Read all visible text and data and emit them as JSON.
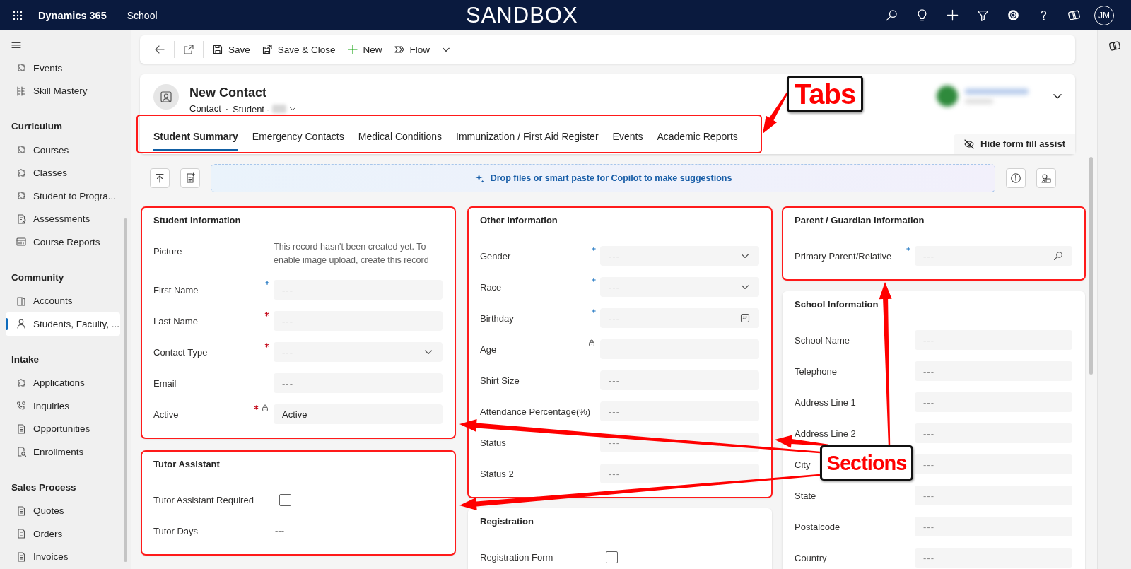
{
  "top_bar": {
    "app_name": "Dynamics 365",
    "area": "School",
    "environment": "SANDBOX",
    "user_initials": "JM"
  },
  "sidebar": {
    "groups": [
      {
        "items": [
          {
            "label": "Events",
            "selected": false
          },
          {
            "label": "Skill Mastery",
            "selected": false
          }
        ]
      },
      {
        "title": "Curriculum",
        "items": [
          {
            "label": "Courses",
            "selected": false
          },
          {
            "label": "Classes",
            "selected": false
          },
          {
            "label": "Student to Progra...",
            "selected": false
          },
          {
            "label": "Assessments",
            "selected": false
          },
          {
            "label": "Course Reports",
            "selected": false
          }
        ]
      },
      {
        "title": "Community",
        "items": [
          {
            "label": "Accounts",
            "selected": false
          },
          {
            "label": "Students, Faculty, ...",
            "selected": true
          }
        ]
      },
      {
        "title": "Intake",
        "items": [
          {
            "label": "Applications",
            "selected": false
          },
          {
            "label": "Inquiries",
            "selected": false
          },
          {
            "label": "Opportunities",
            "selected": false
          },
          {
            "label": "Enrollments",
            "selected": false
          }
        ]
      },
      {
        "title": "Sales Process",
        "items": [
          {
            "label": "Quotes",
            "selected": false
          },
          {
            "label": "Orders",
            "selected": false
          },
          {
            "label": "Invoices",
            "selected": false
          }
        ]
      }
    ]
  },
  "command_bar": {
    "commands": [
      {
        "label": "Save",
        "menu": false
      },
      {
        "label": "Save & Close",
        "menu": false
      },
      {
        "label": "New",
        "menu": false
      },
      {
        "label": "Flow",
        "menu": true
      }
    ]
  },
  "record": {
    "title": "New Contact",
    "entity": "Contact",
    "separator": "·",
    "form_name": "Student -"
  },
  "tabs": [
    {
      "label": "Student Summary",
      "selected": true
    },
    {
      "label": "Emergency Contacts",
      "selected": false
    },
    {
      "label": "Medical Conditions",
      "selected": false
    },
    {
      "label": "Immunization / First Aid Register",
      "selected": false
    },
    {
      "label": "Events",
      "selected": false
    },
    {
      "label": "Academic Reports",
      "selected": false
    }
  ],
  "form_fill_assist": "Hide form fill assist",
  "copilot_prompt": "Drop files or smart paste for Copilot to make suggestions",
  "columns": [
    {
      "sections": [
        {
          "title": "Student Information",
          "highlighted": true,
          "fields": [
            {
              "label": "Picture",
              "kind": "note",
              "required": false,
              "recommended": false,
              "locked": false,
              "value": "This record hasn't been created yet. To enable image upload, create this record"
            },
            {
              "label": "First Name",
              "kind": "text",
              "required": false,
              "recommended": true,
              "locked": false,
              "placeholder": "---"
            },
            {
              "label": "Last Name",
              "kind": "text",
              "required": true,
              "recommended": false,
              "locked": false,
              "placeholder": "---"
            },
            {
              "label": "Contact Type",
              "kind": "select",
              "required": true,
              "recommended": false,
              "locked": false,
              "placeholder": "---"
            },
            {
              "label": "Email",
              "kind": "text",
              "required": false,
              "recommended": false,
              "locked": false,
              "placeholder": "---"
            },
            {
              "label": "Active",
              "kind": "text",
              "required": true,
              "recommended": false,
              "locked": true,
              "value": "Active"
            }
          ]
        },
        {
          "title": "Tutor Assistant",
          "highlighted": true,
          "fields": [
            {
              "label": "Tutor Assistant Required",
              "kind": "checkbox",
              "required": false,
              "recommended": false,
              "locked": false,
              "checked": false
            },
            {
              "label": "Tutor Days",
              "kind": "plain",
              "required": false,
              "recommended": false,
              "locked": false,
              "value": "---"
            }
          ]
        }
      ]
    },
    {
      "sections": [
        {
          "title": "Other Information",
          "highlighted": true,
          "fields": [
            {
              "label": "Gender",
              "kind": "select",
              "required": false,
              "recommended": true,
              "locked": false,
              "placeholder": "---"
            },
            {
              "label": "Race",
              "kind": "select",
              "required": false,
              "recommended": true,
              "locked": false,
              "placeholder": "---"
            },
            {
              "label": "Birthday",
              "kind": "date",
              "required": false,
              "recommended": true,
              "locked": false,
              "placeholder": "---"
            },
            {
              "label": "Age",
              "kind": "text",
              "required": false,
              "recommended": false,
              "locked": true
            },
            {
              "label": "Shirt Size",
              "kind": "text",
              "required": false,
              "recommended": false,
              "locked": false,
              "placeholder": "---"
            },
            {
              "label": "Attendance Percentage(%)",
              "kind": "text",
              "required": false,
              "recommended": false,
              "locked": false,
              "placeholder": "---"
            },
            {
              "label": "Status",
              "kind": "text",
              "required": false,
              "recommended": false,
              "locked": false,
              "placeholder": "---"
            },
            {
              "label": "Status 2",
              "kind": "text",
              "required": false,
              "recommended": false,
              "locked": false,
              "placeholder": "---"
            }
          ]
        },
        {
          "title": "Registration",
          "highlighted": false,
          "fields": [
            {
              "label": "Registration Form",
              "kind": "checkbox",
              "required": false,
              "recommended": false,
              "locked": false,
              "checked": false
            }
          ]
        }
      ]
    },
    {
      "sections": [
        {
          "title": "Parent / Guardian Information",
          "highlighted": true,
          "fields": [
            {
              "label": "Primary Parent/Relative",
              "kind": "lookup",
              "required": false,
              "recommended": true,
              "locked": false,
              "placeholder": "---"
            }
          ]
        },
        {
          "title": "School Information",
          "highlighted": false,
          "fields": [
            {
              "label": "School Name",
              "kind": "text",
              "required": false,
              "recommended": false,
              "locked": false,
              "placeholder": "---"
            },
            {
              "label": "Telephone",
              "kind": "text",
              "required": false,
              "recommended": false,
              "locked": false,
              "placeholder": "---"
            },
            {
              "label": "Address Line 1",
              "kind": "text",
              "required": false,
              "recommended": false,
              "locked": false,
              "placeholder": "---"
            },
            {
              "label": "Address Line 2",
              "kind": "text",
              "required": false,
              "recommended": false,
              "locked": false,
              "placeholder": "---"
            },
            {
              "label": "City",
              "kind": "text",
              "required": false,
              "recommended": false,
              "locked": false,
              "placeholder": "---"
            },
            {
              "label": "State",
              "kind": "text",
              "required": false,
              "recommended": false,
              "locked": false,
              "placeholder": "---"
            },
            {
              "label": "Postalcode",
              "kind": "text",
              "required": false,
              "recommended": false,
              "locked": false,
              "placeholder": "---"
            },
            {
              "label": "Country",
              "kind": "text",
              "required": false,
              "recommended": false,
              "locked": false,
              "placeholder": "---"
            }
          ]
        }
      ]
    }
  ],
  "annotations": [
    {
      "text": "Tabs"
    },
    {
      "text": "Sections"
    }
  ]
}
